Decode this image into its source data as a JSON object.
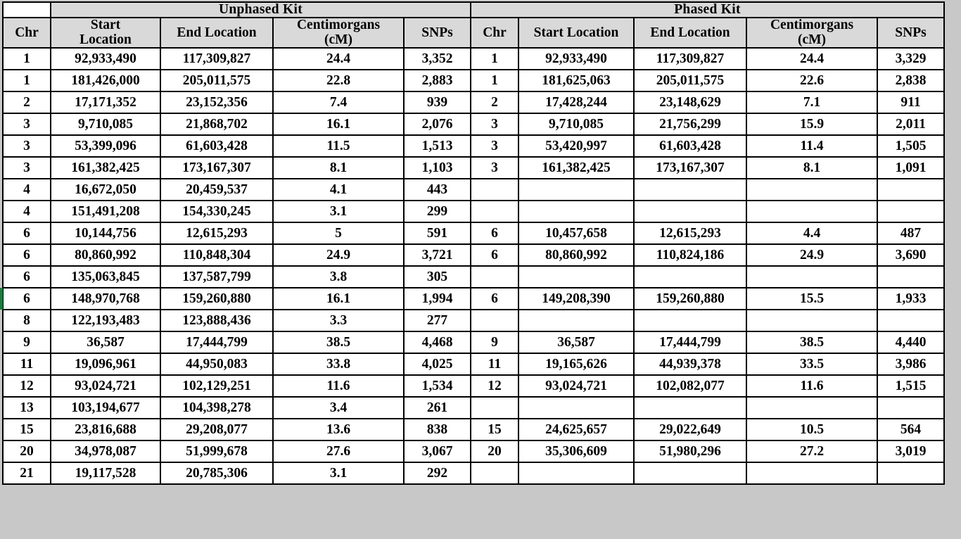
{
  "table": {
    "group_headers": [
      {
        "label": "",
        "span": 1
      },
      {
        "label": "Unphased Kit",
        "span": 4
      },
      {
        "label": "Phased Kit",
        "span": 5
      }
    ],
    "unphased_group_label": "Unphased Kit",
    "phased_group_label": "Phased Kit",
    "columns": [
      "Chr",
      "Start Location",
      "End Location",
      "Centimorgans (cM)",
      "SNPs",
      "Chr",
      "Start Location",
      "End Location",
      "Centimorgans (cM)",
      "SNPs"
    ],
    "column_headers": {
      "chr": "Chr",
      "start_location": "Start Location",
      "start_location_line1": "Start",
      "start_location_line2": "Location",
      "end_location": "End Location",
      "centimorgans_line1": "Centimorgans",
      "centimorgans_line2": "(cM)",
      "snps": "SNPs"
    },
    "highlight_color": "#ffff00",
    "header_background": "#d9d9d9",
    "rows": [
      {
        "unphased": {
          "chr": "1",
          "start": "92,933,490",
          "end": "117,309,827",
          "cm": "24.4",
          "snps": "3,352",
          "cm_highlight": false
        },
        "phased": {
          "chr": "1",
          "start": "92,933,490",
          "end": "117,309,827",
          "cm": "24.4",
          "snps": "3,329"
        }
      },
      {
        "unphased": {
          "chr": "1",
          "start": "181,426,000",
          "end": "205,011,575",
          "cm": "22.8",
          "snps": "2,883",
          "cm_highlight": false
        },
        "phased": {
          "chr": "1",
          "start": "181,625,063",
          "end": "205,011,575",
          "cm": "22.6",
          "snps": "2,838"
        }
      },
      {
        "unphased": {
          "chr": "2",
          "start": "17,171,352",
          "end": "23,152,356",
          "cm": "7.4",
          "snps": "939",
          "cm_highlight": false
        },
        "phased": {
          "chr": "2",
          "start": "17,428,244",
          "end": "23,148,629",
          "cm": "7.1",
          "snps": "911"
        }
      },
      {
        "unphased": {
          "chr": "3",
          "start": "9,710,085",
          "end": "21,868,702",
          "cm": "16.1",
          "snps": "2,076",
          "cm_highlight": false
        },
        "phased": {
          "chr": "3",
          "start": "9,710,085",
          "end": "21,756,299",
          "cm": "15.9",
          "snps": "2,011"
        }
      },
      {
        "unphased": {
          "chr": "3",
          "start": "53,399,096",
          "end": "61,603,428",
          "cm": "11.5",
          "snps": "1,513",
          "cm_highlight": false
        },
        "phased": {
          "chr": "3",
          "start": "53,420,997",
          "end": "61,603,428",
          "cm": "11.4",
          "snps": "1,505"
        }
      },
      {
        "unphased": {
          "chr": "3",
          "start": "161,382,425",
          "end": "173,167,307",
          "cm": "8.1",
          "snps": "1,103",
          "cm_highlight": false
        },
        "phased": {
          "chr": "3",
          "start": "161,382,425",
          "end": "173,167,307",
          "cm": "8.1",
          "snps": "1,091"
        }
      },
      {
        "unphased": {
          "chr": "4",
          "start": "16,672,050",
          "end": "20,459,537",
          "cm": "4.1",
          "snps": "443",
          "cm_highlight": true
        },
        "phased": {
          "chr": "",
          "start": "",
          "end": "",
          "cm": "",
          "snps": ""
        }
      },
      {
        "unphased": {
          "chr": "4",
          "start": "151,491,208",
          "end": "154,330,245",
          "cm": "3.1",
          "snps": "299",
          "cm_highlight": true
        },
        "phased": {
          "chr": "",
          "start": "",
          "end": "",
          "cm": "",
          "snps": ""
        }
      },
      {
        "unphased": {
          "chr": "6",
          "start": "10,144,756",
          "end": "12,615,293",
          "cm": "5",
          "snps": "591",
          "cm_highlight": true
        },
        "phased": {
          "chr": "6",
          "start": "10,457,658",
          "end": "12,615,293",
          "cm": "4.4",
          "snps": "487"
        }
      },
      {
        "unphased": {
          "chr": "6",
          "start": "80,860,992",
          "end": "110,848,304",
          "cm": "24.9",
          "snps": "3,721",
          "cm_highlight": false
        },
        "phased": {
          "chr": "6",
          "start": "80,860,992",
          "end": "110,824,186",
          "cm": "24.9",
          "snps": "3,690"
        }
      },
      {
        "unphased": {
          "chr": "6",
          "start": "135,063,845",
          "end": "137,587,799",
          "cm": "3.8",
          "snps": "305",
          "cm_highlight": false
        },
        "phased": {
          "chr": "",
          "start": "",
          "end": "",
          "cm": "",
          "snps": ""
        }
      },
      {
        "unphased": {
          "chr": "6",
          "start": "148,970,768",
          "end": "159,260,880",
          "cm": "16.1",
          "snps": "1,994",
          "cm_highlight": false
        },
        "phased": {
          "chr": "6",
          "start": "149,208,390",
          "end": "159,260,880",
          "cm": "15.5",
          "snps": "1,933"
        },
        "selected": true
      },
      {
        "unphased": {
          "chr": "8",
          "start": "122,193,483",
          "end": "123,888,436",
          "cm": "3.3",
          "snps": "277",
          "cm_highlight": true
        },
        "phased": {
          "chr": "",
          "start": "",
          "end": "",
          "cm": "",
          "snps": ""
        }
      },
      {
        "unphased": {
          "chr": "9",
          "start": "36,587",
          "end": "17,444,799",
          "cm": "38.5",
          "snps": "4,468",
          "cm_highlight": false
        },
        "phased": {
          "chr": "9",
          "start": "36,587",
          "end": "17,444,799",
          "cm": "38.5",
          "snps": "4,440"
        }
      },
      {
        "unphased": {
          "chr": "11",
          "start": "19,096,961",
          "end": "44,950,083",
          "cm": "33.8",
          "snps": "4,025",
          "cm_highlight": false
        },
        "phased": {
          "chr": "11",
          "start": "19,165,626",
          "end": "44,939,378",
          "cm": "33.5",
          "snps": "3,986"
        }
      },
      {
        "unphased": {
          "chr": "12",
          "start": "93,024,721",
          "end": "102,129,251",
          "cm": "11.6",
          "snps": "1,534",
          "cm_highlight": false
        },
        "phased": {
          "chr": "12",
          "start": "93,024,721",
          "end": "102,082,077",
          "cm": "11.6",
          "snps": "1,515"
        }
      },
      {
        "unphased": {
          "chr": "13",
          "start": "103,194,677",
          "end": "104,398,278",
          "cm": "3.4",
          "snps": "261",
          "cm_highlight": true
        },
        "phased": {
          "chr": "",
          "start": "",
          "end": "",
          "cm": "",
          "snps": ""
        }
      },
      {
        "unphased": {
          "chr": "15",
          "start": "23,816,688",
          "end": "29,208,077",
          "cm": "13.6",
          "snps": "838",
          "cm_highlight": false
        },
        "phased": {
          "chr": "15",
          "start": "24,625,657",
          "end": "29,022,649",
          "cm": "10.5",
          "snps": "564"
        }
      },
      {
        "unphased": {
          "chr": "20",
          "start": "34,978,087",
          "end": "51,999,678",
          "cm": "27.6",
          "snps": "3,067",
          "cm_highlight": false
        },
        "phased": {
          "chr": "20",
          "start": "35,306,609",
          "end": "51,980,296",
          "cm": "27.2",
          "snps": "3,019"
        }
      },
      {
        "unphased": {
          "chr": "21",
          "start": "19,117,528",
          "end": "20,785,306",
          "cm": "3.1",
          "snps": "292",
          "cm_highlight": true
        },
        "phased": {
          "chr": "",
          "start": "",
          "end": "",
          "cm": "",
          "snps": ""
        }
      }
    ]
  }
}
